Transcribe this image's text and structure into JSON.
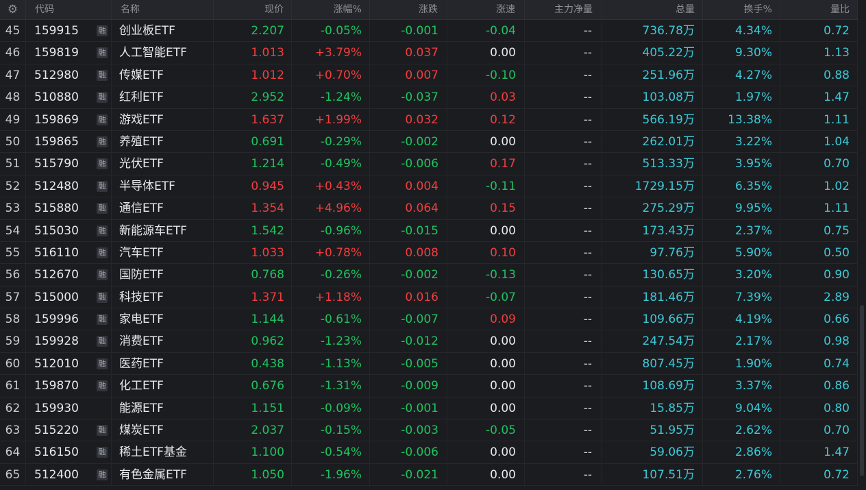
{
  "columns": {
    "code": "代码",
    "name": "名称",
    "price": "现价",
    "change_pct": "涨幅%",
    "change": "涨跌",
    "speed": "涨速",
    "main_net_flow": "主力净量",
    "volume": "总量",
    "turnover_pct": "换手%",
    "volume_ratio": "量比"
  },
  "rong_label": "融",
  "rows": [
    {
      "idx": "45",
      "code": "159915",
      "rong": true,
      "name": "创业板ETF",
      "price": "2.207",
      "price_c": "green",
      "chg": "-0.05%",
      "chg_c": "green",
      "diff": "-0.001",
      "diff_c": "green",
      "spd": "-0.04",
      "spd_c": "green",
      "flow": "--",
      "vol": "736.78万",
      "turn": "4.34%",
      "ratio": "0.72"
    },
    {
      "idx": "46",
      "code": "159819",
      "rong": true,
      "name": "人工智能ETF",
      "price": "1.013",
      "price_c": "red",
      "chg": "+3.79%",
      "chg_c": "red",
      "diff": "0.037",
      "diff_c": "red",
      "spd": "0.00",
      "spd_c": "white",
      "flow": "--",
      "vol": "405.22万",
      "turn": "9.30%",
      "ratio": "1.13"
    },
    {
      "idx": "47",
      "code": "512980",
      "rong": true,
      "name": "传媒ETF",
      "price": "1.012",
      "price_c": "red",
      "chg": "+0.70%",
      "chg_c": "red",
      "diff": "0.007",
      "diff_c": "red",
      "spd": "-0.10",
      "spd_c": "green",
      "flow": "--",
      "vol": "251.96万",
      "turn": "4.27%",
      "ratio": "0.88"
    },
    {
      "idx": "48",
      "code": "510880",
      "rong": true,
      "name": "红利ETF",
      "price": "2.952",
      "price_c": "green",
      "chg": "-1.24%",
      "chg_c": "green",
      "diff": "-0.037",
      "diff_c": "green",
      "spd": "0.03",
      "spd_c": "red",
      "flow": "--",
      "vol": "103.08万",
      "turn": "1.97%",
      "ratio": "1.47"
    },
    {
      "idx": "49",
      "code": "159869",
      "rong": true,
      "name": "游戏ETF",
      "price": "1.637",
      "price_c": "red",
      "chg": "+1.99%",
      "chg_c": "red",
      "diff": "0.032",
      "diff_c": "red",
      "spd": "0.12",
      "spd_c": "red",
      "flow": "--",
      "vol": "566.19万",
      "turn": "13.38%",
      "ratio": "1.11"
    },
    {
      "idx": "50",
      "code": "159865",
      "rong": true,
      "name": "养殖ETF",
      "price": "0.691",
      "price_c": "green",
      "chg": "-0.29%",
      "chg_c": "green",
      "diff": "-0.002",
      "diff_c": "green",
      "spd": "0.00",
      "spd_c": "white",
      "flow": "--",
      "vol": "262.01万",
      "turn": "3.22%",
      "ratio": "1.04"
    },
    {
      "idx": "51",
      "code": "515790",
      "rong": true,
      "name": "光伏ETF",
      "price": "1.214",
      "price_c": "green",
      "chg": "-0.49%",
      "chg_c": "green",
      "diff": "-0.006",
      "diff_c": "green",
      "spd": "0.17",
      "spd_c": "red",
      "flow": "--",
      "vol": "513.33万",
      "turn": "3.95%",
      "ratio": "0.70"
    },
    {
      "idx": "52",
      "code": "512480",
      "rong": true,
      "name": "半导体ETF",
      "price": "0.945",
      "price_c": "red",
      "chg": "+0.43%",
      "chg_c": "red",
      "diff": "0.004",
      "diff_c": "red",
      "spd": "-0.11",
      "spd_c": "green",
      "flow": "--",
      "vol": "1729.15万",
      "turn": "6.35%",
      "ratio": "1.02"
    },
    {
      "idx": "53",
      "code": "515880",
      "rong": true,
      "name": "通信ETF",
      "price": "1.354",
      "price_c": "red",
      "chg": "+4.96%",
      "chg_c": "red",
      "diff": "0.064",
      "diff_c": "red",
      "spd": "0.15",
      "spd_c": "red",
      "flow": "--",
      "vol": "275.29万",
      "turn": "9.95%",
      "ratio": "1.11"
    },
    {
      "idx": "54",
      "code": "515030",
      "rong": true,
      "name": "新能源车ETF",
      "price": "1.542",
      "price_c": "green",
      "chg": "-0.96%",
      "chg_c": "green",
      "diff": "-0.015",
      "diff_c": "green",
      "spd": "0.00",
      "spd_c": "white",
      "flow": "--",
      "vol": "173.43万",
      "turn": "2.37%",
      "ratio": "0.75"
    },
    {
      "idx": "55",
      "code": "516110",
      "rong": true,
      "name": "汽车ETF",
      "price": "1.033",
      "price_c": "red",
      "chg": "+0.78%",
      "chg_c": "red",
      "diff": "0.008",
      "diff_c": "red",
      "spd": "0.10",
      "spd_c": "red",
      "flow": "--",
      "vol": "97.76万",
      "turn": "5.90%",
      "ratio": "0.50"
    },
    {
      "idx": "56",
      "code": "512670",
      "rong": true,
      "name": "国防ETF",
      "price": "0.768",
      "price_c": "green",
      "chg": "-0.26%",
      "chg_c": "green",
      "diff": "-0.002",
      "diff_c": "green",
      "spd": "-0.13",
      "spd_c": "green",
      "flow": "--",
      "vol": "130.65万",
      "turn": "3.20%",
      "ratio": "0.90"
    },
    {
      "idx": "57",
      "code": "515000",
      "rong": true,
      "name": "科技ETF",
      "price": "1.371",
      "price_c": "red",
      "chg": "+1.18%",
      "chg_c": "red",
      "diff": "0.016",
      "diff_c": "red",
      "spd": "-0.07",
      "spd_c": "green",
      "flow": "--",
      "vol": "181.46万",
      "turn": "7.39%",
      "ratio": "2.89"
    },
    {
      "idx": "58",
      "code": "159996",
      "rong": true,
      "name": "家电ETF",
      "price": "1.144",
      "price_c": "green",
      "chg": "-0.61%",
      "chg_c": "green",
      "diff": "-0.007",
      "diff_c": "green",
      "spd": "0.09",
      "spd_c": "red",
      "flow": "--",
      "vol": "109.66万",
      "turn": "4.19%",
      "ratio": "0.66"
    },
    {
      "idx": "59",
      "code": "159928",
      "rong": true,
      "name": "消费ETF",
      "price": "0.962",
      "price_c": "green",
      "chg": "-1.23%",
      "chg_c": "green",
      "diff": "-0.012",
      "diff_c": "green",
      "spd": "0.00",
      "spd_c": "white",
      "flow": "--",
      "vol": "247.54万",
      "turn": "2.17%",
      "ratio": "0.98"
    },
    {
      "idx": "60",
      "code": "512010",
      "rong": true,
      "name": "医药ETF",
      "price": "0.438",
      "price_c": "green",
      "chg": "-1.13%",
      "chg_c": "green",
      "diff": "-0.005",
      "diff_c": "green",
      "spd": "0.00",
      "spd_c": "white",
      "flow": "--",
      "vol": "807.45万",
      "turn": "1.90%",
      "ratio": "0.74"
    },
    {
      "idx": "61",
      "code": "159870",
      "rong": true,
      "name": "化工ETF",
      "price": "0.676",
      "price_c": "green",
      "chg": "-1.31%",
      "chg_c": "green",
      "diff": "-0.009",
      "diff_c": "green",
      "spd": "0.00",
      "spd_c": "white",
      "flow": "--",
      "vol": "108.69万",
      "turn": "3.37%",
      "ratio": "0.86"
    },
    {
      "idx": "62",
      "code": "159930",
      "rong": false,
      "name": "能源ETF",
      "price": "1.151",
      "price_c": "green",
      "chg": "-0.09%",
      "chg_c": "green",
      "diff": "-0.001",
      "diff_c": "green",
      "spd": "0.00",
      "spd_c": "white",
      "flow": "--",
      "vol": "15.85万",
      "turn": "9.04%",
      "ratio": "0.80"
    },
    {
      "idx": "63",
      "code": "515220",
      "rong": true,
      "name": "煤炭ETF",
      "price": "2.037",
      "price_c": "green",
      "chg": "-0.15%",
      "chg_c": "green",
      "diff": "-0.003",
      "diff_c": "green",
      "spd": "-0.05",
      "spd_c": "green",
      "flow": "--",
      "vol": "51.95万",
      "turn": "2.62%",
      "ratio": "0.70"
    },
    {
      "idx": "64",
      "code": "516150",
      "rong": true,
      "name": "稀土ETF基金",
      "price": "1.100",
      "price_c": "green",
      "chg": "-0.54%",
      "chg_c": "green",
      "diff": "-0.006",
      "diff_c": "green",
      "spd": "0.00",
      "spd_c": "white",
      "flow": "--",
      "vol": "59.06万",
      "turn": "2.86%",
      "ratio": "1.47"
    },
    {
      "idx": "65",
      "code": "512400",
      "rong": true,
      "name": "有色金属ETF",
      "price": "1.050",
      "price_c": "green",
      "chg": "-1.96%",
      "chg_c": "green",
      "diff": "-0.021",
      "diff_c": "green",
      "spd": "0.00",
      "spd_c": "white",
      "flow": "--",
      "vol": "107.51万",
      "turn": "2.76%",
      "ratio": "0.72"
    }
  ]
}
